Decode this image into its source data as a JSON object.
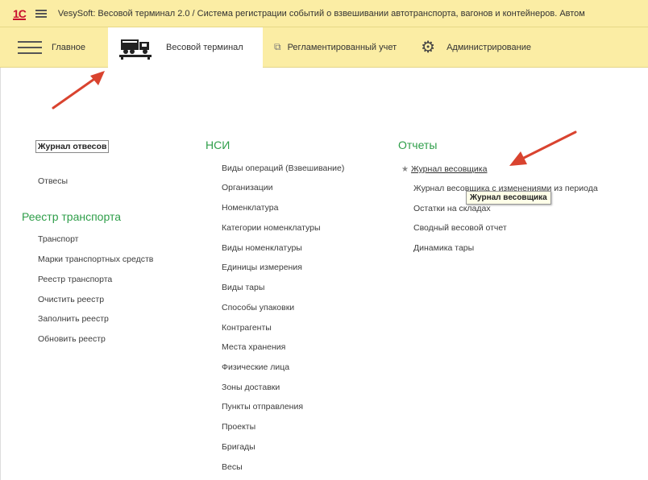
{
  "titlebar": {
    "logo": "1С",
    "title": "VesySoft: Весовой терминал 2.0 / Система регистрации событий о взвешивании автотранспорта, вагонов и контейнеров. Автом"
  },
  "navbar": {
    "main_label": "Главное",
    "terminal_label": "Весовой терминал",
    "reg_label": "Регламентированный учет",
    "admin_label": "Администрирование"
  },
  "left": {
    "journal": "Журнал отвесов",
    "otvesy": "Отвесы",
    "registry_title": "Реестр транспорта",
    "registry_items": [
      "Транспорт",
      "Марки транспортных средств",
      "Реестр транспорта",
      "Очистить реестр",
      "Заполнить реестр",
      "Обновить реестр"
    ]
  },
  "nsi": {
    "title": "НСИ",
    "items": [
      "Виды операций (Взвешивание)",
      "Организации",
      "Номенклатура",
      "Категории номенклатуры",
      "Виды номенклатуры",
      "Единицы измерения",
      "Виды тары",
      "Способы упаковки",
      "Контрагенты",
      "Места хранения",
      "Физические лица",
      "Зоны доставки",
      "Пункты отправления",
      "Проекты",
      "Бригады",
      "Весы"
    ]
  },
  "reports": {
    "title": "Отчеты",
    "star": "★",
    "items": [
      "Журнал весовщика",
      "Журнал весовщика с изменениями из периода",
      "Остатки на складах",
      "Сводный весовой отчет",
      "Динамика тары"
    ],
    "tooltip": "Журнал весовщика"
  },
  "colors": {
    "band": "#fbeda4",
    "section_green": "#2e9e49",
    "arrow_red": "#d9432f"
  }
}
